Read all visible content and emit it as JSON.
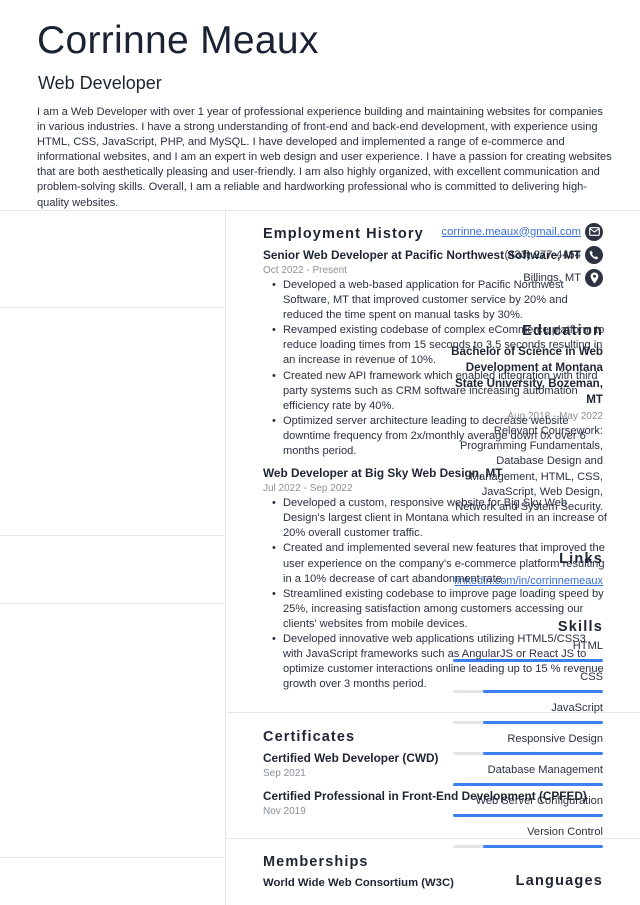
{
  "header": {
    "name": "Corrinne Meaux",
    "job_title": "Web Developer",
    "summary": "I am a Web Developer with over 1 year of professional experience building and maintaining websites for companies in various industries. I have a strong understanding of front-end and back-end development, with experience using HTML, CSS, JavaScript, PHP, and MySQL. I have developed and implemented a range of e-commerce and informational websites, and I am an expert in web design and user experience. I have a passion for creating websites that are both aesthetically pleasing and user-friendly. I am also highly organized, with excellent communication and problem-solving skills. Overall, I am a reliable and hardworking professional who is committed to delivering high-quality websites."
  },
  "contact": {
    "email": "corrinne.meaux@gmail.com",
    "phone": "(433) 277-4464",
    "location": "Billings, MT",
    "email_icon": "envelope-icon",
    "phone_icon": "phone-icon",
    "location_icon": "map-pin-icon"
  },
  "education": {
    "heading": "Education",
    "degree": "Bachelor of Science in Web Development at Montana State University, Bozeman, MT",
    "dates": "Aug 2018 - May 2022",
    "description": "Relevant Coursework: Programming Fundamentals, Database Design and Management, HTML, CSS, JavaScript, Web Design, Network and System Security."
  },
  "links": {
    "heading": "Links",
    "items": [
      "linkedin.com/in/corrinnemeaux"
    ]
  },
  "skills": {
    "heading": "Skills",
    "accent_color": "#3b7ff0",
    "items": [
      {
        "name": "HTML",
        "level": 1.0
      },
      {
        "name": "CSS",
        "level": 0.8
      },
      {
        "name": "JavaScript",
        "level": 0.8
      },
      {
        "name": "Responsive Design",
        "level": 0.8
      },
      {
        "name": "Database Management",
        "level": 1.0
      },
      {
        "name": "Web Server Configuration",
        "level": 1.0
      },
      {
        "name": "Version Control",
        "level": 0.8
      }
    ]
  },
  "languages": {
    "heading": "Languages"
  },
  "employment": {
    "heading": "Employment History",
    "jobs": [
      {
        "title": "Senior Web Developer at Pacific Northwest Software, MT",
        "dates": "Oct 2022 - Present",
        "bullets": [
          "Developed a web-based application for Pacific Northwest Software, MT that improved customer service by 20% and reduced the time spent on manual tasks by 30%.",
          "Revamped existing codebase of complex eCommerce platform to reduce loading times from 15 seconds to 3.5 seconds resulting in an increase in revenue of 10%.",
          "Created new API framework which enabled integration with third party systems such as CRM software increasing automation efficiency rate by 40%.",
          "Optimized server architecture leading to decrease website downtime frequency from 2x/monthly average down 0x over 6 months period."
        ]
      },
      {
        "title": "Web Developer at Big Sky Web Design, MT",
        "dates": "Jul 2022 - Sep 2022",
        "bullets": [
          "Developed a custom, responsive website for Big Sky Web Design's largest client in Montana which resulted in an increase of 20% overall customer traffic.",
          "Created and implemented several new features that improved the user experience on the company's e-commerce platform resulting in a 10% decrease of cart abandonment rate.",
          "Streamlined existing codebase to improve page loading speed by 25%, increasing satisfaction among customers accessing our clients' websites from mobile devices.",
          "Developed innovative web applications utilizing HTML5/CSS3 with JavaScript frameworks such as AngularJS or React JS to optimize customer interactions online leading up to 15 % revenue growth over 3 months period."
        ]
      }
    ]
  },
  "certificates": {
    "heading": "Certificates",
    "items": [
      {
        "name": "Certified Web Developer (CWD)",
        "date": "Sep 2021"
      },
      {
        "name": "Certified Professional in Front-End Development (CPFED)",
        "date": "Nov 2019"
      }
    ]
  },
  "memberships": {
    "heading": "Memberships",
    "items": [
      "World Wide Web Consortium (W3C)"
    ]
  }
}
